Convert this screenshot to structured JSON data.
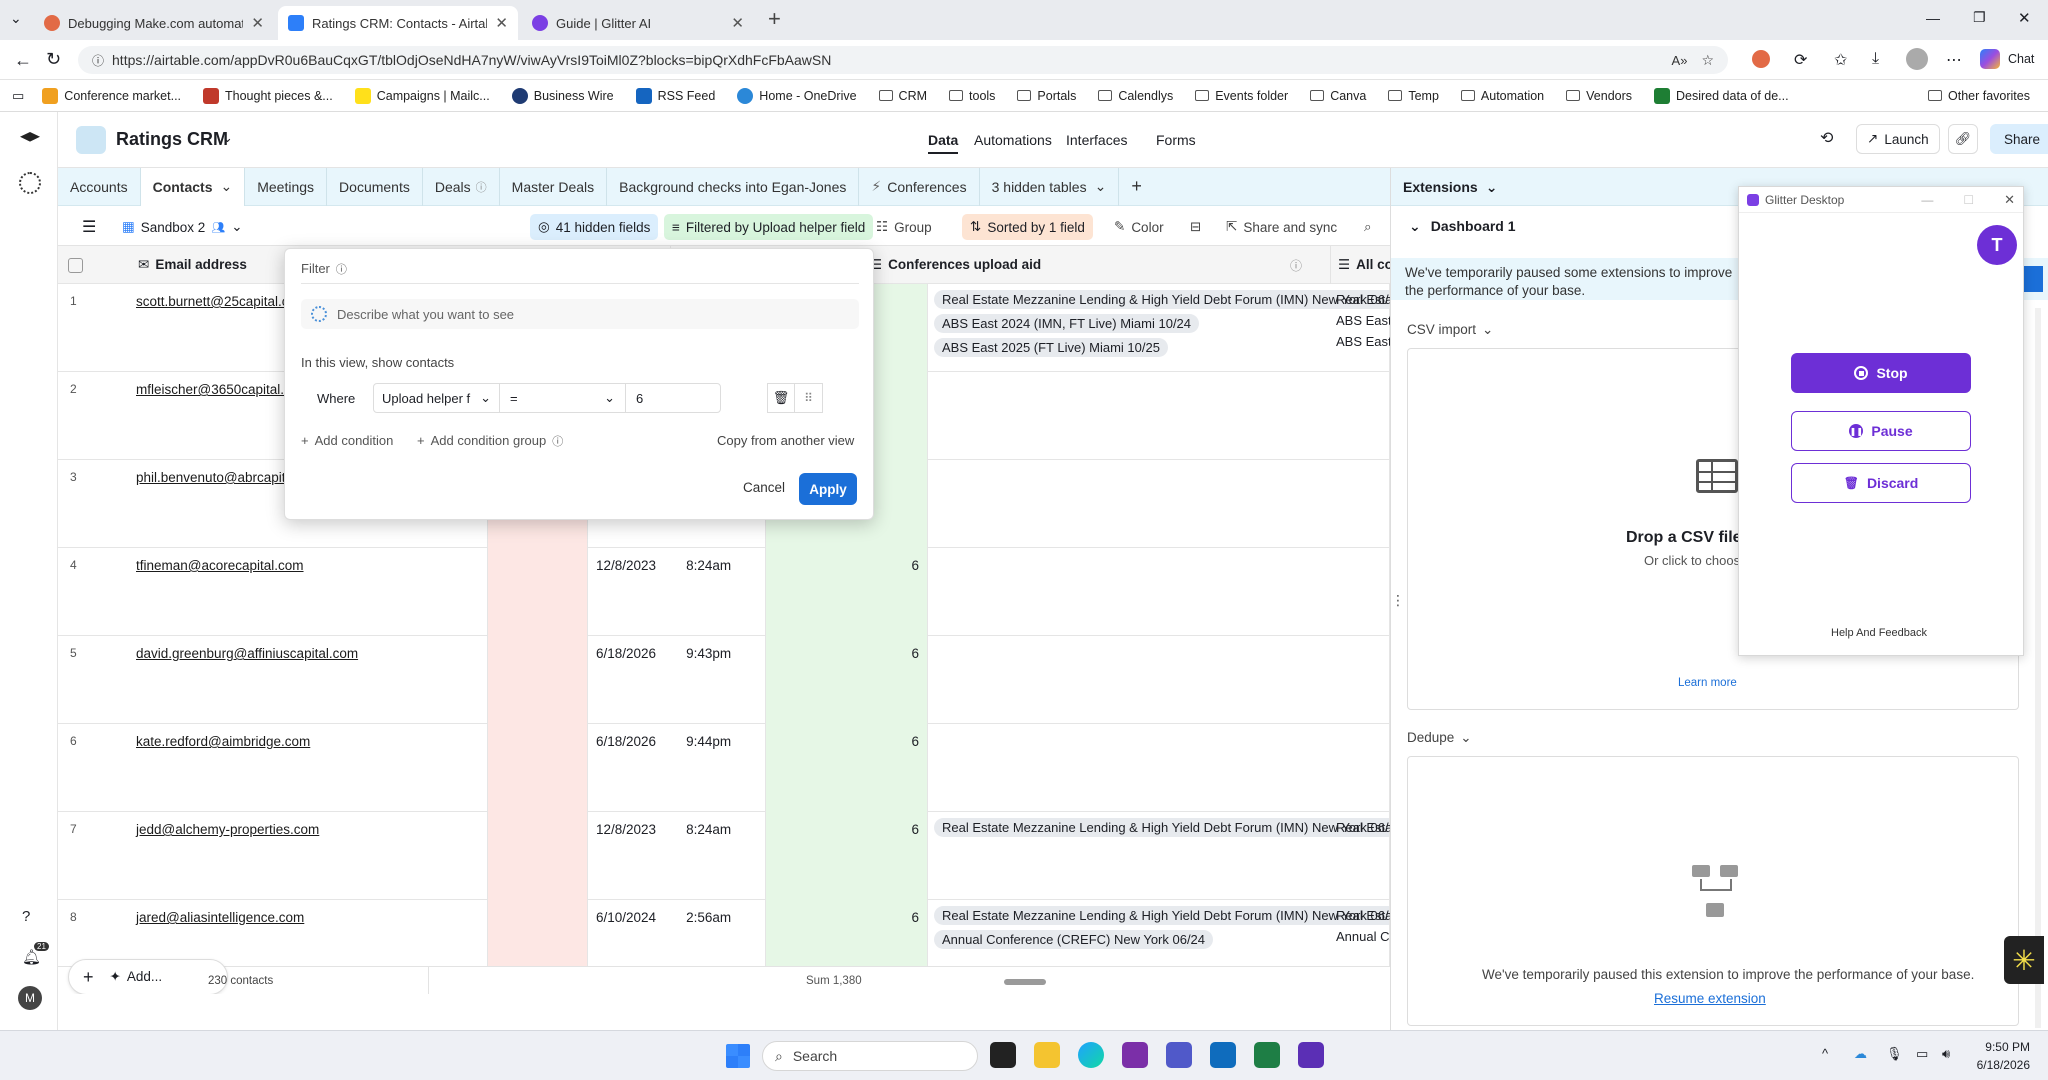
{
  "browser": {
    "tabs": [
      {
        "title": "Debugging Make.com automation",
        "color": "#e26a46"
      },
      {
        "title": "Ratings CRM: Contacts - Airtable",
        "color": "#2d7ff9"
      },
      {
        "title": "Guide | Glitter AI",
        "color": "#7b3fe4"
      }
    ],
    "url": "https://airtable.com/appDvR0u6BauCqxGT/tblOdjOseNdHA7nyW/viwAyVrsI9ToiMl0Z?blocks=bipQrXdhFcFbAawSN",
    "chat_label": "Chat",
    "favorites": [
      "Conference market...",
      "Thought pieces &...",
      "Campaigns | Mailc...",
      "Business Wire",
      "RSS Feed",
      "Home - OneDrive",
      "CRM",
      "tools",
      "Portals",
      "Calendlys",
      "Events folder",
      "Canva",
      "Temp",
      "Automation",
      "Vendors",
      "Desired data of de..."
    ],
    "other_favorites": "Other favorites"
  },
  "airtable": {
    "base_name": "Ratings CRM",
    "nav": [
      "Data",
      "Automations",
      "Interfaces",
      "Forms"
    ],
    "launch": "Launch",
    "share": "Share",
    "rail_badge": "21",
    "avatar": "M",
    "tables": [
      "Accounts",
      "Contacts",
      "Meetings",
      "Documents",
      "Deals",
      "Master Deals",
      "Background checks into Egan-Jones",
      "Conferences",
      "3 hidden tables"
    ],
    "view_name": "Sandbox 2",
    "hidden_fields": "41 hidden fields",
    "filtered": "Filtered by Upload helper field",
    "group": "Group",
    "sorted": "Sorted by 1 field",
    "color": "Color",
    "share_sync": "Share and sync",
    "columns": {
      "email": "Email address",
      "conf": "Conferences upload aid",
      "allco": "All co"
    },
    "rows": [
      {
        "n": "1",
        "email": "scott.burnett@25capital.c",
        "date": "",
        "time": "",
        "num": "",
        "conf": [
          "Real Estate Mezzanine Lending & High Yield Debt Forum (IMN) New York 06/2",
          "ABS East 2024 (IMN, FT Live) Miami 10/24",
          "ABS East 2025 (FT Live) Miami 10/25"
        ],
        "all": [
          "Real Esta",
          "ABS East",
          "ABS East"
        ]
      },
      {
        "n": "2",
        "email": "mfleischer@3650capital.c",
        "date": "",
        "time": "",
        "num": "",
        "conf": [],
        "all": []
      },
      {
        "n": "3",
        "email": "phil.benvenuto@abrcapit",
        "date": "",
        "time": "",
        "num": "",
        "conf": [],
        "all": []
      },
      {
        "n": "4",
        "email": "tfineman@acorecapital.com",
        "date": "12/8/2023",
        "time": "8:24am",
        "num": "6",
        "conf": [],
        "all": []
      },
      {
        "n": "5",
        "email": "david.greenburg@affiniuscapital.com",
        "date": "6/18/2026",
        "time": "9:43pm",
        "num": "6",
        "conf": [],
        "all": []
      },
      {
        "n": "6",
        "email": "kate.redford@aimbridge.com",
        "date": "6/18/2026",
        "time": "9:44pm",
        "num": "6",
        "conf": [],
        "all": []
      },
      {
        "n": "7",
        "email": "jedd@alchemy-properties.com",
        "date": "12/8/2023",
        "time": "8:24am",
        "num": "6",
        "conf": [
          "Real Estate Mezzanine Lending & High Yield Debt Forum (IMN) New York 06/2"
        ],
        "all": [
          "Real Esta"
        ]
      },
      {
        "n": "8",
        "email": "jared@aliasintelligence.com",
        "date": "6/10/2024",
        "time": "2:56am",
        "num": "6",
        "conf": [
          "Real Estate Mezzanine Lending & High Yield Debt Forum (IMN) New York 06/2",
          "Annual Conference (CREFC) New York 06/24"
        ],
        "all": [
          "Real Esta",
          "Annual C"
        ]
      }
    ],
    "footer": {
      "add": "Add...",
      "count": "230 contacts",
      "sum": "Sum 1,380"
    }
  },
  "filter": {
    "title": "Filter",
    "ai_placeholder": "Describe what you want to see",
    "show_text": "In this view, show contacts",
    "where": "Where",
    "field": "Upload helper f",
    "operator": "=",
    "value": "6",
    "add_condition": "Add condition",
    "add_group": "Add condition group",
    "copy": "Copy from another view",
    "cancel": "Cancel",
    "apply": "Apply"
  },
  "extensions": {
    "title": "Extensions",
    "dashboard": "Dashboard 1",
    "paused_banner": "We've temporarily paused some extensions to improve the performance of your base.",
    "csv": "CSV import",
    "drop": "Drop a CSV file",
    "click": "Or click to choos",
    "learn": "Learn more",
    "dedupe": "Dedupe",
    "paused_msg": "We've temporarily paused this extension to improve the performance of your base.",
    "resume": "Resume extension"
  },
  "glitter": {
    "title": "Glitter Desktop",
    "avatar": "T",
    "stop": "Stop",
    "pause": "Pause",
    "discard": "Discard",
    "help": "Help And Feedback"
  },
  "taskbar": {
    "search": "Search",
    "time": "9:50 PM",
    "date": "6/18/2026"
  },
  "colors": {
    "accent": "#1b6fd8",
    "purple": "#6d2fd6",
    "sort": "#fde4d3",
    "filter": "#d8f5dd",
    "hidden": "#dbeefd"
  }
}
